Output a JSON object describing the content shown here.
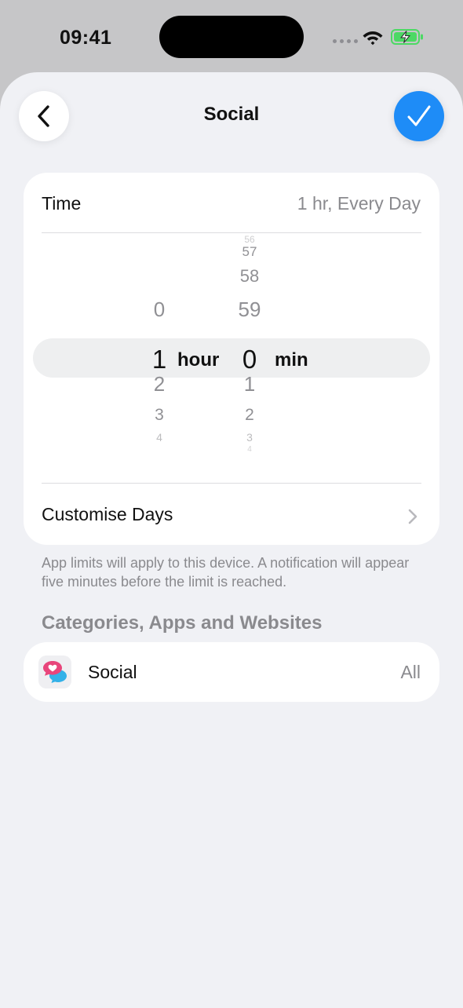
{
  "status_bar": {
    "time": "09:41"
  },
  "nav": {
    "title": "Social",
    "back_icon": "chevron-left-icon",
    "done_icon": "checkmark-icon",
    "accent_color": "#1e8cf7"
  },
  "time_section": {
    "label": "Time",
    "value": "1 hr, Every Day"
  },
  "picker": {
    "hour_options": [
      "0",
      "1",
      "2",
      "3",
      "4"
    ],
    "minute_options": [
      "56",
      "57",
      "58",
      "59",
      "0",
      "1",
      "2",
      "3",
      "4"
    ],
    "selected_hour": "1",
    "hour_unit": "hour",
    "selected_minute": "0",
    "minute_unit": "min"
  },
  "customise_days": {
    "label": "Customise Days"
  },
  "footnote": "App limits will apply to this device. A notification will appear five minutes before the limit is reached.",
  "categories_section": {
    "header": "Categories, Apps and Websites",
    "items": [
      {
        "name": "Social",
        "value": "All",
        "icon": "social-chat-heart-icon"
      }
    ]
  }
}
